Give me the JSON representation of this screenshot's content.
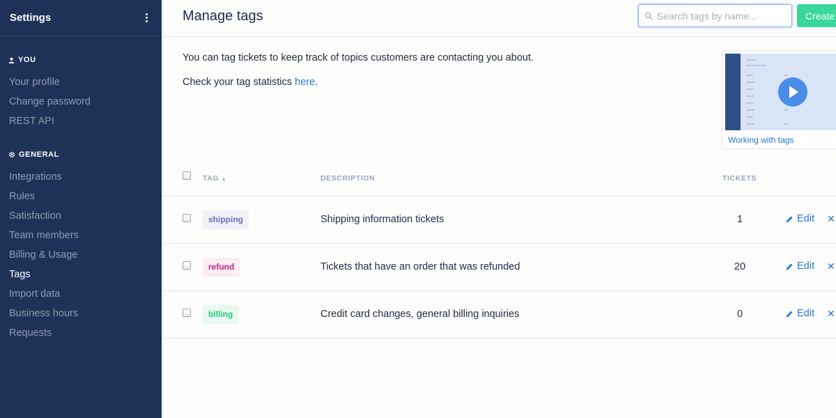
{
  "sidebar": {
    "title": "Settings",
    "sections": [
      {
        "label": "YOU",
        "icon": "user-icon",
        "items": [
          "Your profile",
          "Change password",
          "REST API"
        ]
      },
      {
        "label": "GENERAL",
        "icon": "gear-icon",
        "items": [
          "Integrations",
          "Rules",
          "Satisfaction",
          "Team members",
          "Billing & Usage",
          "Tags",
          "Import data",
          "Business hours",
          "Requests"
        ]
      }
    ],
    "active_item": "Tags"
  },
  "header": {
    "title": "Manage tags",
    "search_placeholder": "Search tags by name...",
    "create_label": "Create"
  },
  "intro": {
    "line1": "You can tag tickets to keep track of topics customers are contacting you about.",
    "line2_prefix": "Check your tag statistics ",
    "line2_link": "here",
    "line2_suffix": "."
  },
  "video": {
    "caption": "Working with tags"
  },
  "table": {
    "columns": {
      "tag": "TAG",
      "description": "DESCRIPTION",
      "tickets": "TICKETS"
    },
    "rows": [
      {
        "tag": "shipping",
        "description": "Shipping information tickets",
        "tickets": "1",
        "edit": "Edit",
        "tag_color": "#6b6fb0",
        "tag_bg": "#f1f1f7"
      },
      {
        "tag": "refund",
        "description": "Tickets that have an order that was refunded",
        "tickets": "20",
        "edit": "Edit",
        "tag_color": "#c0248c",
        "tag_bg": "#f8eef4"
      },
      {
        "tag": "billing",
        "description": "Credit card changes, general billing inquiries",
        "tickets": "0",
        "edit": "Edit",
        "tag_color": "#27c77f",
        "tag_bg": "#eaf9f0"
      }
    ]
  },
  "colors": {
    "sidebar_bg": "#1e3258",
    "accent_link": "#2479d1",
    "create_button": "#3ad89b"
  }
}
